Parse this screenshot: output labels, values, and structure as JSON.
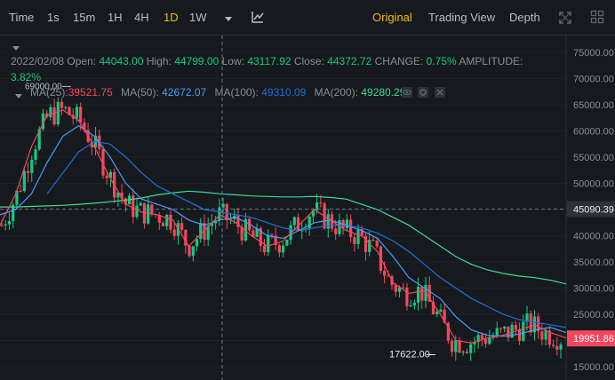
{
  "toolbar": {
    "intervals": [
      "Time",
      "1s",
      "15m",
      "1H",
      "4H",
      "1D",
      "1W"
    ],
    "active_interval": "1D",
    "views": [
      "Original",
      "Trading View",
      "Depth"
    ],
    "active_view": "Original"
  },
  "ohlc": {
    "date": "2022/02/08",
    "open_label": "Open:",
    "open": "44043.00",
    "high_label": "High:",
    "high": "44799.00",
    "low_label": "Low:",
    "low": "43117.92",
    "close_label": "Close:",
    "close": "44372.72",
    "change_label": "CHANGE:",
    "change": "0.75%",
    "amplitude_label": "AMPLITUDE:",
    "amplitude": "3.82%"
  },
  "ma": {
    "ma25_label": "MA(25):",
    "ma25": "39521.75",
    "ma50_label": "MA(50):",
    "ma50": "42672.07",
    "ma100_label": "MA(100):",
    "ma100": "49310.09",
    "ma200_label": "MA(200):",
    "ma200": "49280.29"
  },
  "colors": {
    "up": "#0ecb81",
    "down": "#f6465d",
    "ma25": "#f6465d",
    "ma50": "#4c9cf8",
    "ma100": "#1e6fd9",
    "ma200": "#3fd89b",
    "accent": "#f0b90b",
    "bg": "#161a1e"
  },
  "chart_data": {
    "type": "candlestick",
    "y_ticks": [
      75000,
      70000,
      65000,
      60000,
      55000,
      50000,
      45000,
      40000,
      35000,
      30000,
      25000,
      20000,
      15000
    ],
    "ylim": [
      14000,
      77000
    ],
    "crosshair_price": "45090.39",
    "last_price": "19951.86",
    "max_label": "69000.00",
    "min_label": "17622.00",
    "ma25": [
      42000,
      48000,
      57000,
      63000,
      64000,
      62000,
      57000,
      51000,
      46000,
      44500,
      44000,
      43000,
      38000,
      41000,
      44000,
      42500,
      40000,
      38000,
      39000,
      42000,
      45000,
      43000,
      41000,
      40000,
      37000,
      31000,
      29000,
      29500,
      25000,
      20000,
      19500,
      20500,
      21000,
      22000,
      23000,
      21500,
      20500
    ],
    "ma50": [
      44000,
      45000,
      48000,
      54000,
      59000,
      61000,
      59000,
      55000,
      50000,
      47000,
      46000,
      45000,
      43000,
      42000,
      43000,
      43500,
      42000,
      40000,
      39500,
      41000,
      42500,
      43000,
      42000,
      41000,
      39500,
      36000,
      32000,
      30000,
      28000,
      24500,
      22000,
      21000,
      20800,
      21200,
      22000,
      22500,
      21500
    ],
    "ma100": [
      null,
      null,
      null,
      48000,
      52000,
      56000,
      58000,
      57500,
      55000,
      52000,
      49500,
      48000,
      46500,
      45000,
      44500,
      44000,
      43500,
      42500,
      41500,
      41000,
      41500,
      42000,
      42000,
      41500,
      40500,
      39000,
      37000,
      34500,
      32000,
      30000,
      28000,
      26500,
      25000,
      24000,
      23500,
      23000,
      22500
    ],
    "ma200": [
      45500,
      45500,
      45600,
      45700,
      45800,
      46000,
      46200,
      46500,
      46800,
      47200,
      47800,
      48200,
      48500,
      48300,
      48000,
      47800,
      47600,
      47500,
      47400,
      47400,
      47500,
      47300,
      47000,
      46000,
      45000,
      43500,
      42000,
      40000,
      38000,
      36000,
      34500,
      33500,
      32800,
      32300,
      32000,
      31500,
      30800
    ]
  }
}
